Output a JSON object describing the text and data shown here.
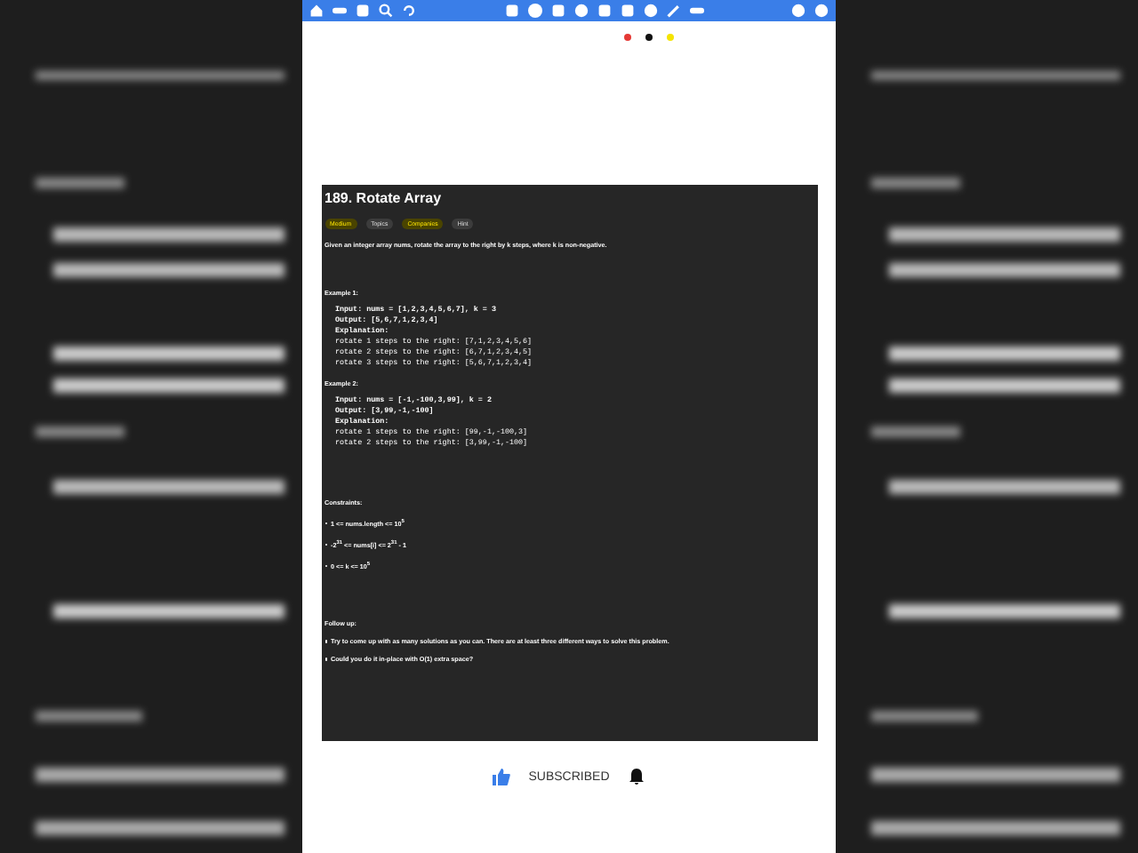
{
  "color_dots": [
    {
      "color": "#e53935"
    },
    {
      "color": "#111111"
    },
    {
      "color": "#f5e400"
    }
  ],
  "problem": {
    "title": "189. Rotate Array",
    "tags": [
      {
        "label": "Medium",
        "kind": "difficulty"
      },
      {
        "label": "Topics",
        "kind": "plain"
      },
      {
        "label": "Companies",
        "kind": "highlight"
      },
      {
        "label": "Hint",
        "kind": "plain"
      }
    ],
    "description": "Given an integer array nums, rotate the array to the right by k steps, where k is non-negative.",
    "examples": [
      {
        "heading": "Example 1:",
        "lines": [
          "Input: nums = [1,2,3,4,5,6,7], k = 3",
          "Output: [5,6,7,1,2,3,4]",
          "Explanation:",
          "rotate 1 steps to the right: [7,1,2,3,4,5,6]",
          "rotate 2 steps to the right: [6,7,1,2,3,4,5]",
          "rotate 3 steps to the right: [5,6,7,1,2,3,4]"
        ]
      },
      {
        "heading": "Example 2:",
        "lines": [
          "Input: nums = [-1,-100,3,99], k = 2",
          "Output: [3,99,-1,-100]",
          "Explanation:",
          "rotate 1 steps to the right: [99,-1,-100,3]",
          "rotate 2 steps to the right: [3,99,-1,-100]"
        ]
      }
    ],
    "constraints_heading": "Constraints:",
    "constraints": [
      "1 <= nums.length <= 10$^{5}$",
      "-2$^{31}$ <= nums[i] <= 2$^{31}$ - 1",
      "0 <= k <= 10$^{5}$"
    ],
    "followup_heading": "Follow up:",
    "followup": [
      "Try to come up with as many solutions as you can. There are at least three different ways to solve this problem.",
      "Could you do it in-place with O(1) extra space?"
    ]
  },
  "subscribe": {
    "label": "SUBSCRIBED"
  }
}
